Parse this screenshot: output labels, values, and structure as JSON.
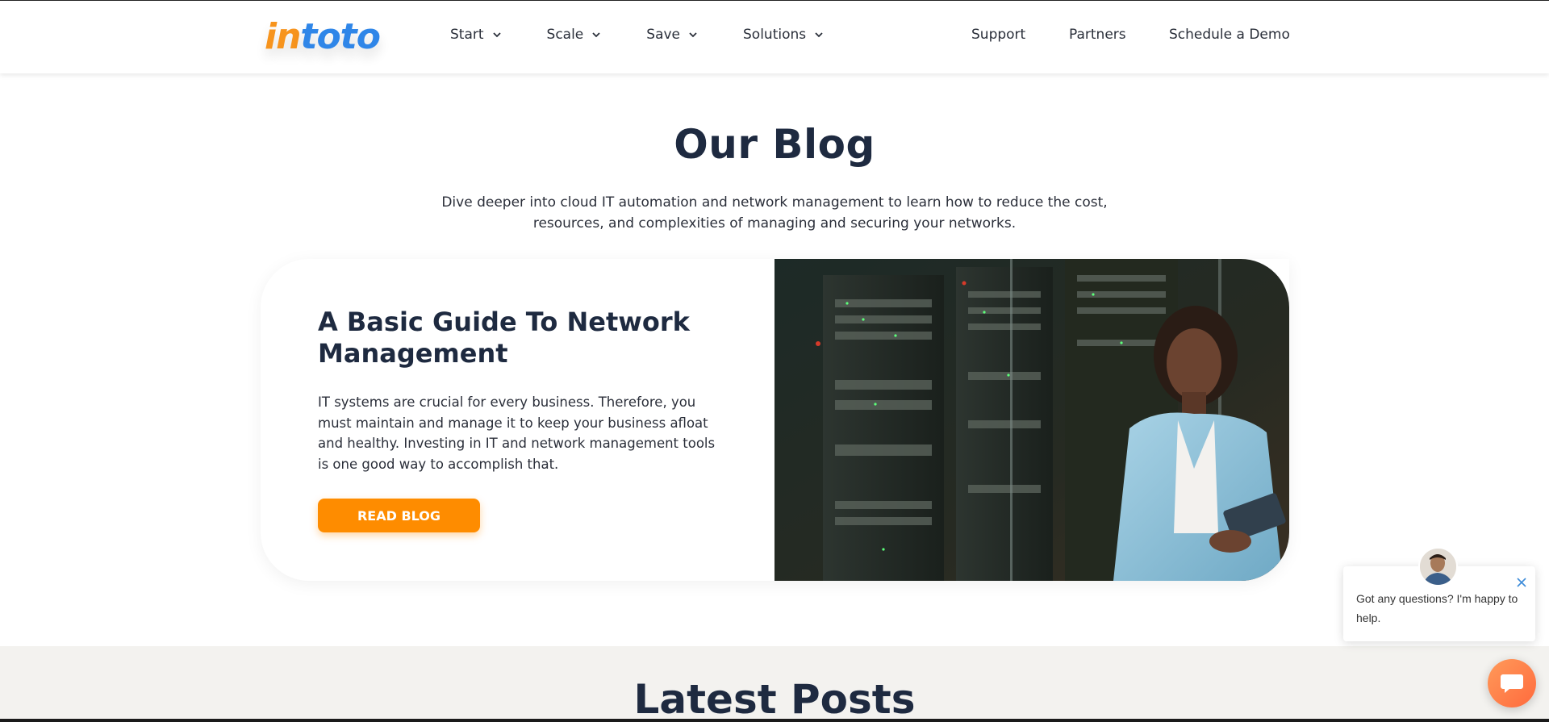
{
  "brand": {
    "logo_in": "in",
    "logo_toto": "toto"
  },
  "nav": {
    "left": [
      {
        "label": "Start"
      },
      {
        "label": "Scale"
      },
      {
        "label": "Save"
      },
      {
        "label": "Solutions"
      }
    ],
    "right": {
      "support": "Support",
      "partners": "Partners",
      "demo": "Schedule a Demo"
    }
  },
  "hero": {
    "title": "Our Blog",
    "subtitle": "Dive deeper into cloud IT automation and network management to learn how to reduce the cost, resources, and complexities of managing and securing your networks."
  },
  "featured": {
    "title": "A Basic Guide To Network Management",
    "excerpt": "IT systems are crucial for every business. Therefore, you must maintain and manage it to keep your business afloat and healthy. Investing in IT and network management tools is one good way to accomplish that.",
    "button_label": "READ BLOG"
  },
  "latest": {
    "title": "Latest Posts"
  },
  "chat": {
    "message": "Got any questions? I'm happy to help."
  },
  "colors": {
    "accent": "#fe8c00",
    "heading": "#1e2a40",
    "logo_orange": "#f7941d",
    "logo_blue": "#2f86e8"
  },
  "icons": {
    "nav_dropdown": "chevron-down-icon",
    "chat_close": "close-icon",
    "chat_launcher": "chat-bubble-icon"
  }
}
